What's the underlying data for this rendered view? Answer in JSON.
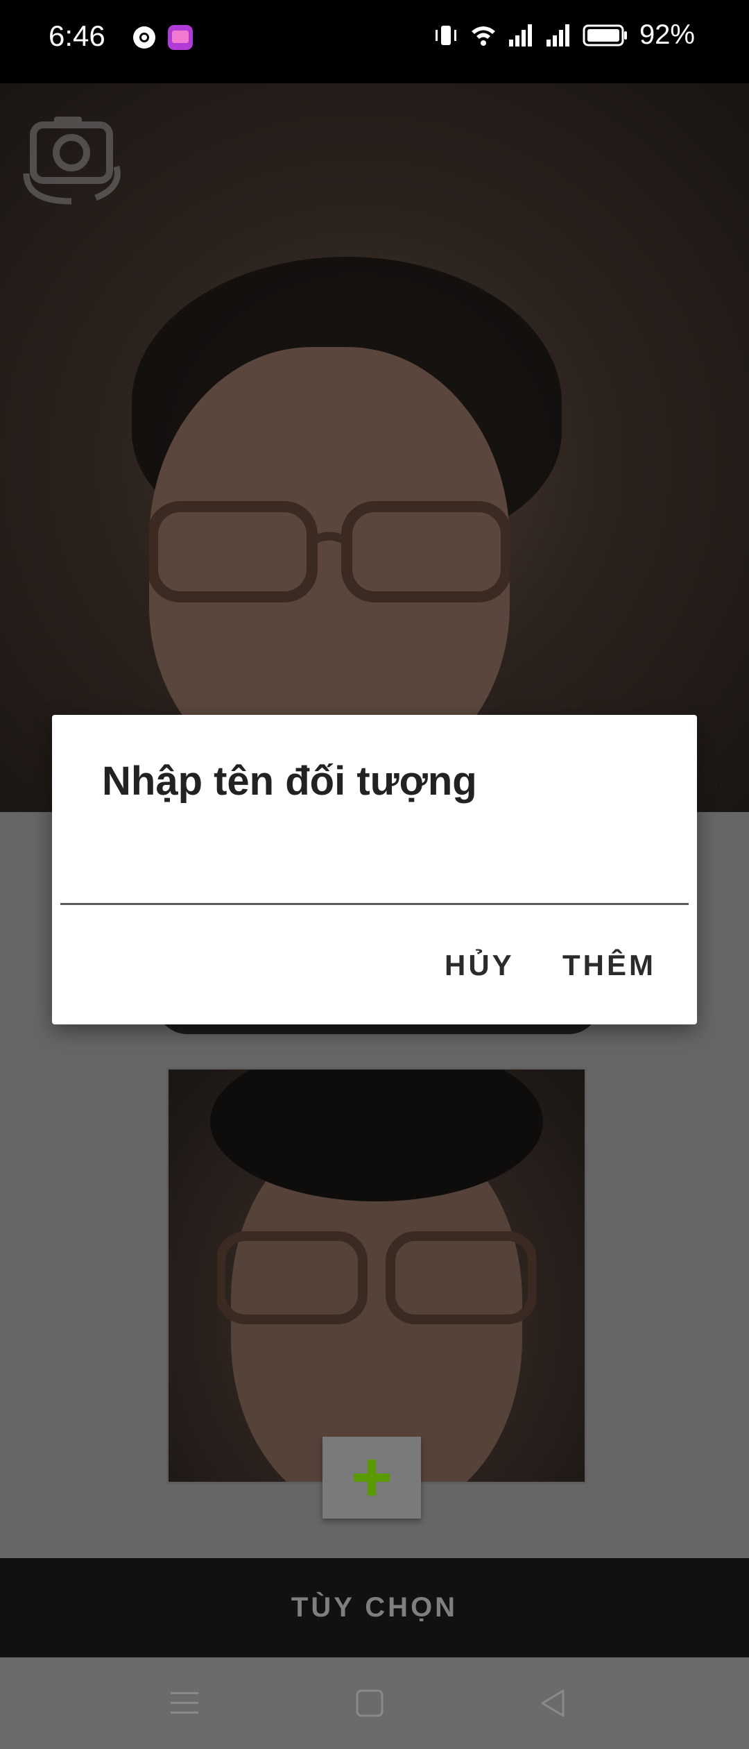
{
  "status_bar": {
    "time": "6:46",
    "battery": "92%"
  },
  "dialog": {
    "title": "Nhập tên đối tượng",
    "input_value": "",
    "cancel_label": "HỦY",
    "add_label": "THÊM"
  },
  "bottom_bar": {
    "label": "TÙY CHỌN"
  },
  "colors": {
    "accent_plus": "#5a9a00",
    "dialog_bg": "#ffffff",
    "scrim": "#6b6b6b"
  }
}
